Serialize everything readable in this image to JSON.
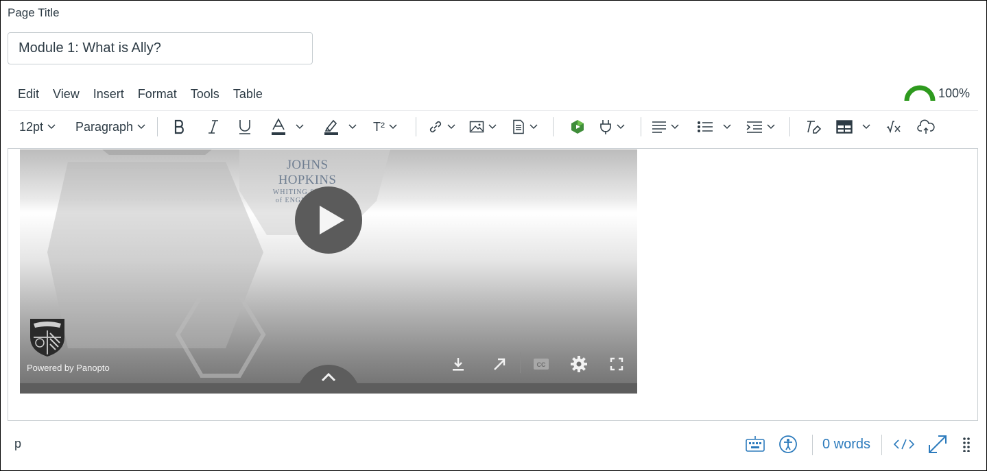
{
  "page_title": {
    "label": "Page Title",
    "value": "Module 1: What is Ally?"
  },
  "menubar": {
    "items": [
      {
        "label": "Edit"
      },
      {
        "label": "View"
      },
      {
        "label": "Insert"
      },
      {
        "label": "Format"
      },
      {
        "label": "Tools"
      },
      {
        "label": "Table"
      }
    ]
  },
  "accessibility_score": {
    "percent_label": "100%",
    "value": 100,
    "color": "#2e9a1e",
    "icon": "gauge-icon"
  },
  "toolbar": {
    "font_size": "12pt",
    "block_format": "Paragraph",
    "superscript_label": "T²",
    "icons": [
      "bold-icon",
      "italic-icon",
      "underline-icon",
      "text-color-icon",
      "highlight-icon",
      "superscript-icon",
      "link-icon",
      "image-icon",
      "document-icon",
      "media-plugin-icon",
      "apps-plug-icon",
      "align-icon",
      "bullet-list-icon",
      "indent-icon",
      "clear-format-icon",
      "table-icon",
      "math-icon",
      "cloud-icon"
    ]
  },
  "video": {
    "logo_name": "JOHNS HOPKINS",
    "logo_line1": "WHITING SCHOOL",
    "logo_line2": "of ENGINEERING",
    "powered_by": "Powered by Panopto",
    "controls": [
      "download-icon",
      "open-external-icon",
      "closed-caption-icon",
      "settings-gear-icon",
      "fullscreen-icon"
    ]
  },
  "statusbar": {
    "path": "p",
    "word_count": "0 words",
    "icons": [
      "keyboard-icon",
      "accessibility-checker-icon",
      "html-editor-icon",
      "fullscreen-expand-icon",
      "resize-handle-icon"
    ]
  },
  "colors": {
    "text": "#2d3b45",
    "link_blue": "#2b7abc",
    "border": "#c7cdd1",
    "ally_green": "#2e9a1e"
  }
}
